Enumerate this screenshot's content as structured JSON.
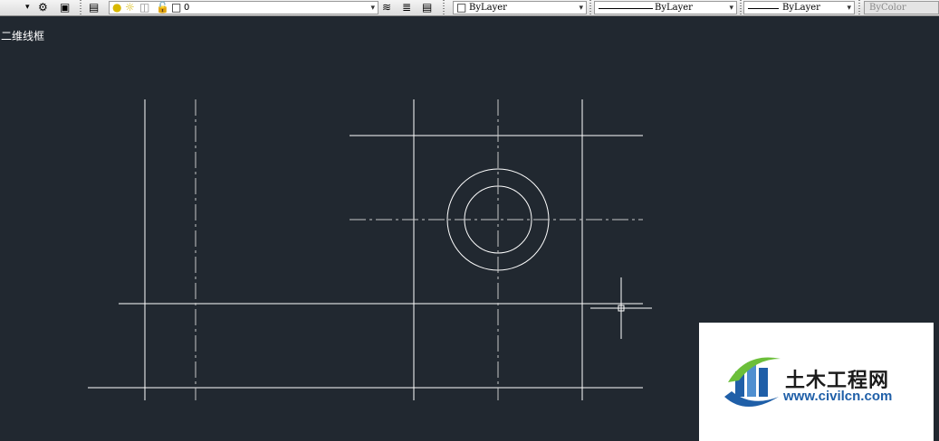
{
  "toolbar": {
    "layer_name": "0",
    "color_value": "ByLayer",
    "linetype_value": "ByLayer",
    "lineweight_value": "ByLayer",
    "plotstyle_value": "ByColor"
  },
  "viewport": {
    "label": "二维线框"
  },
  "watermark": {
    "site_name": "土木工程网",
    "url": "www.civilcn.com"
  },
  "colors": {
    "canvas_bg": "#212830",
    "line": "#ffffff",
    "centerline": "#c8c8c8",
    "logo_blue": "#1f5fa8",
    "logo_green": "#6cbf3a"
  }
}
